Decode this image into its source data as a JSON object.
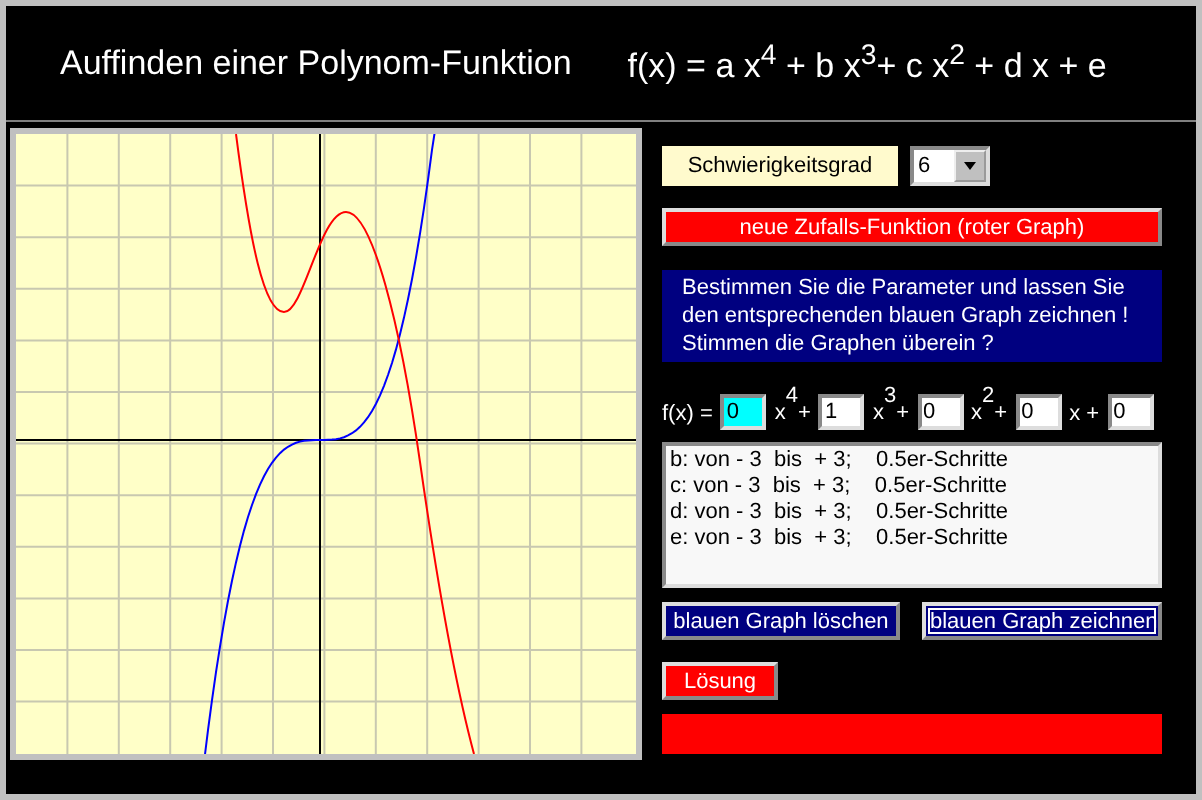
{
  "header": {
    "title": "Auffinden einer Polynom-Funktion",
    "formula": "f(x) = a x$^{4}$ + b x$^{3}$+ c x$^{2}$ + d x + e"
  },
  "difficulty": {
    "label": "Schwierigkeitsgrad",
    "value": "6"
  },
  "random_button": "neue Zufalls-Funktion (roter Graph)",
  "instructions": "Bestimmen Sie die Parameter und lassen Sie den entsprechenden blauen Graph zeichnen ! Stimmen die Graphen überein ?",
  "polynomial": {
    "label": "f(x) =",
    "fields": [
      {
        "value": "0",
        "selected": true,
        "variable": "x",
        "power": "4",
        "sign": "+"
      },
      {
        "value": "1",
        "selected": false,
        "variable": "x",
        "power": "3",
        "sign": "+"
      },
      {
        "value": "0",
        "selected": false,
        "variable": "x",
        "power": "2",
        "sign": "+"
      },
      {
        "value": "0",
        "selected": false,
        "variable": "x",
        "sign": "+"
      },
      {
        "value": "0",
        "selected": false
      }
    ]
  },
  "ranges": [
    "b: von - 3  bis  + 3;    0.5er-Schritte",
    "c: von - 3  bis  + 3;    0.5er-Schritte",
    "d: von - 3  bis  + 3;    0.5er-Schritte",
    "e: von - 3  bis  + 3;    0.5er-Schritte"
  ],
  "graph_buttons": [
    {
      "label": "blauen Graph löschen",
      "focused": false
    },
    {
      "label": "blauen Graph zeichnen",
      "focused": true
    }
  ],
  "solution_button": "Lösung"
}
